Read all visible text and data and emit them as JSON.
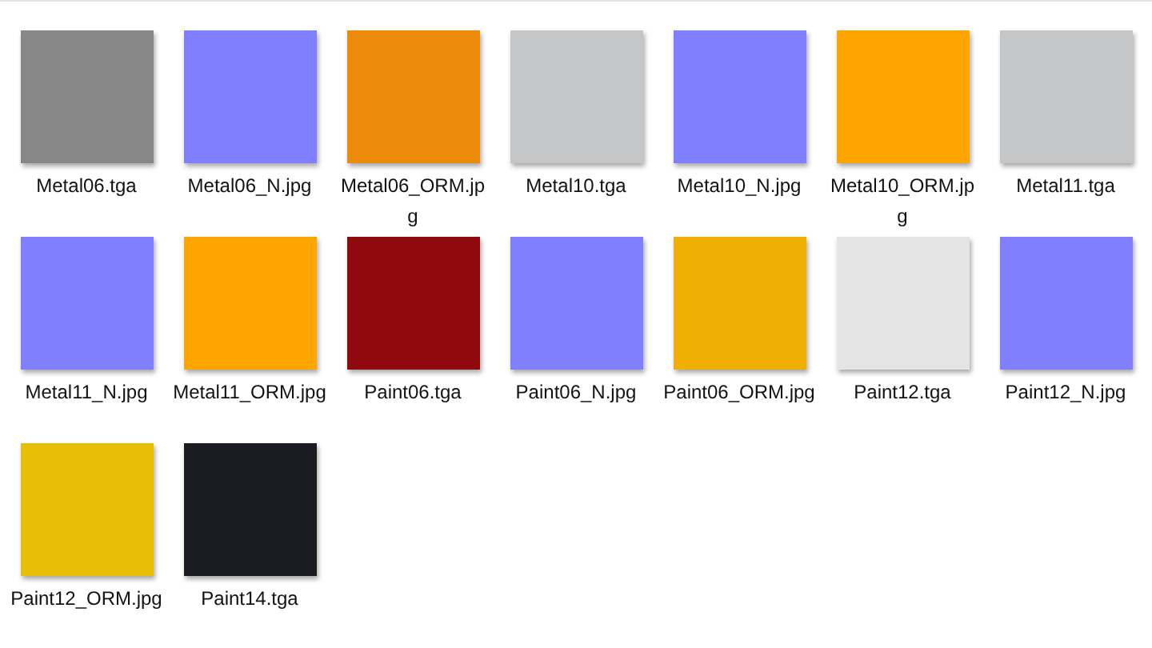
{
  "files": [
    {
      "name": "Metal06.tga",
      "color": "#878787"
    },
    {
      "name": "Metal06_N.jpg",
      "color": "#7f7fff"
    },
    {
      "name": "Metal06_ORM.jpg",
      "color": "#ec8a0c"
    },
    {
      "name": "Metal10.tga",
      "color": "#c4c6c7"
    },
    {
      "name": "Metal10_N.jpg",
      "color": "#7f7fff"
    },
    {
      "name": "Metal10_ORM.jpg",
      "color": "#ffa500"
    },
    {
      "name": "Metal11.tga",
      "color": "#c4c6c7"
    },
    {
      "name": "Metal11_N.jpg",
      "color": "#7f7fff"
    },
    {
      "name": "Metal11_ORM.jpg",
      "color": "#ffa500"
    },
    {
      "name": "Paint06.tga",
      "color": "#8f0a0c"
    },
    {
      "name": "Paint06_N.jpg",
      "color": "#7f7fff"
    },
    {
      "name": "Paint06_ORM.jpg",
      "color": "#efaf04"
    },
    {
      "name": "Paint12.tga",
      "color": "#e4e4e4"
    },
    {
      "name": "Paint12_N.jpg",
      "color": "#7f7fff"
    },
    {
      "name": "Paint12_ORM.jpg",
      "color": "#e9be07"
    },
    {
      "name": "Paint14.tga",
      "color": "#1b1c21"
    }
  ]
}
